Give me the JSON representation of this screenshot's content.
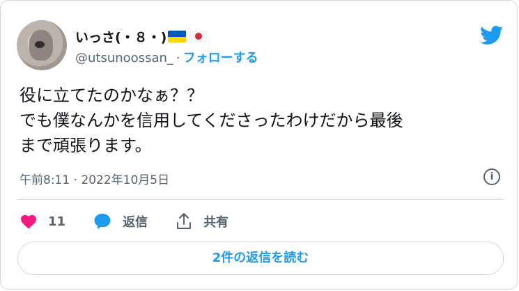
{
  "tweet": {
    "display_name": "いっさ(・８・)",
    "handle": "@utsunoossan_",
    "separator": "·",
    "follow_label": "フォローする",
    "text_lines": [
      "役に立てたのかなぁ？？",
      "でも僕なんかを信用してくださったわけだから最後",
      "まで頑張ります。"
    ],
    "timestamp": "午前8:11 · 2022年10月5日"
  },
  "actions": {
    "like_count": "11",
    "reply_label": "返信",
    "share_label": "共有"
  },
  "read_replies_label": "2件の返信を読む",
  "colors": {
    "accent": "#1d9bf0",
    "like": "#f91880",
    "muted": "#536471",
    "border": "#cfd9de",
    "flag_ua_blue": "#0057b7",
    "flag_ua_yellow": "#ffd700",
    "flag_jp_red": "#d42b3a"
  },
  "icons": [
    "twitter-bird-icon",
    "info-icon",
    "heart-icon",
    "reply-bubble-icon",
    "share-icon",
    "ukraine-flag-icon",
    "japan-flag-icon"
  ]
}
